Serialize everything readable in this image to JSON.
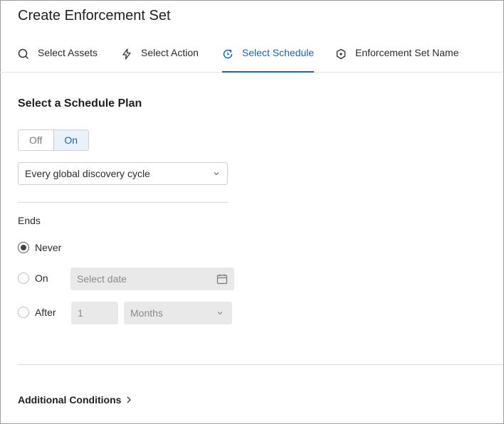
{
  "header": {
    "title": "Create Enforcement Set"
  },
  "tabs": [
    {
      "label": "Select Assets",
      "icon": "search-icon",
      "active": false
    },
    {
      "label": "Select Action",
      "icon": "lightning-icon",
      "active": false
    },
    {
      "label": "Select Schedule",
      "icon": "refresh-clock-icon",
      "active": true
    },
    {
      "label": "Enforcement Set Name",
      "icon": "shield-icon",
      "active": false
    }
  ],
  "schedule": {
    "title": "Select a Schedule Plan",
    "toggle": {
      "off_label": "Off",
      "on_label": "On",
      "selected": "On"
    },
    "plan_value": "Every global discovery cycle",
    "ends_label": "Ends",
    "options": {
      "never_label": "Never",
      "on_label": "On",
      "after_label": "After",
      "selected": "Never"
    },
    "date_placeholder": "Select date",
    "after_count": "1",
    "after_unit": "Months"
  },
  "footer": {
    "additional_conditions": "Additional Conditions"
  },
  "colors": {
    "accent": "#1565c0",
    "toggle_on_bg": "#e8f1fc",
    "disabled_field": "#e9e9e9"
  }
}
